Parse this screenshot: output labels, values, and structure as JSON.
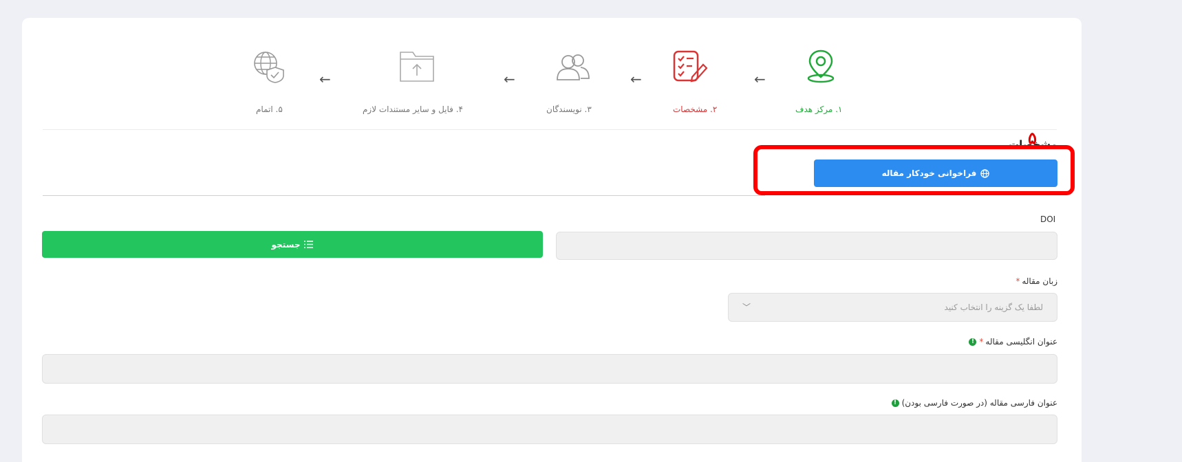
{
  "stepper": {
    "steps": [
      {
        "label": "۱. مرکز هدف",
        "icon": "location-pin-icon",
        "color": "#22a83a"
      },
      {
        "label": "۲. مشخصات",
        "icon": "checklist-pen-icon",
        "color": "#d93535"
      },
      {
        "label": "۳. نویسندگان",
        "icon": "users-icon",
        "color": "#777777"
      },
      {
        "label": "۴. فایل و سایر مستندات لازم",
        "icon": "folder-upload-icon",
        "color": "#777777"
      },
      {
        "label": "۵. اتمام",
        "icon": "globe-shield-icon",
        "color": "#777777"
      }
    ],
    "arrow": "←"
  },
  "annotation": {
    "number": "۵"
  },
  "section": {
    "title": "مشخصات"
  },
  "auto_button": {
    "label": "فراخوانی خودکار مقاله",
    "icon": "globe-icon"
  },
  "doi": {
    "label": "DOI",
    "value": "",
    "search_label": "جستجو",
    "search_icon": "list-icon"
  },
  "language": {
    "label": "زبان مقاله",
    "required": "*",
    "placeholder": "لطفا یک گزینه را انتخاب کنید"
  },
  "english_title": {
    "label": "عنوان انگلیسی مقاله",
    "required": "*",
    "info": "!"
  },
  "persian_title": {
    "label": "عنوان فارسی مقاله (در صورت فارسی بودن)",
    "info": "!"
  },
  "colors": {
    "primary": "#2d8cf0",
    "success": "#22c55e",
    "annotation": "#ff0000"
  }
}
